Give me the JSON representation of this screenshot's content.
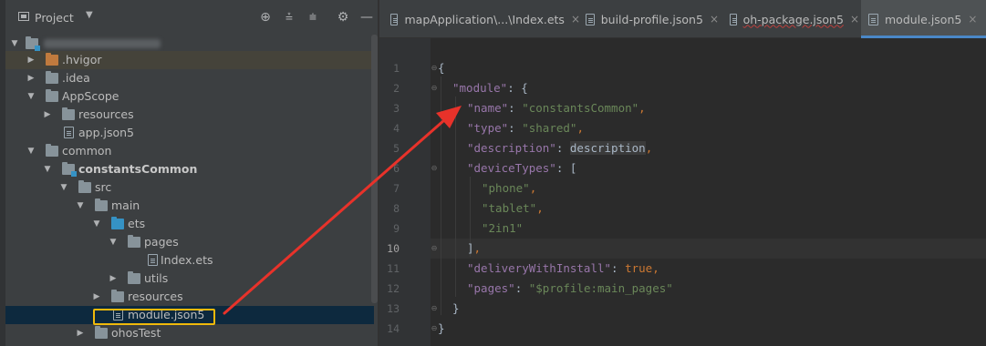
{
  "panel": {
    "title": "Project",
    "dropdown": "▼",
    "tools": [
      {
        "name": "locate-icon",
        "glyph": "⊕"
      },
      {
        "name": "expand-all-icon",
        "glyph": "⩮"
      },
      {
        "name": "collapse-all-icon",
        "glyph": "⩧"
      },
      {
        "name": "gear-icon",
        "glyph": "⚙"
      },
      {
        "name": "minimize-icon",
        "glyph": "—"
      }
    ]
  },
  "tree": {
    "hvigor": ".hvigor",
    "idea": ".idea",
    "appscope": "AppScope",
    "appscope_resources": "resources",
    "app_json5": "app.json5",
    "common": "common",
    "constants_common": "constantsCommon",
    "src": "src",
    "main": "main",
    "ets": "ets",
    "pages": "pages",
    "index_ets": "Index.ets",
    "utils": "utils",
    "main_resources": "resources",
    "module_json5": "module.json5",
    "ohos_test": "ohosTest"
  },
  "tabs": [
    {
      "label": "mapApplication\\...\\Index.ets",
      "close": "×"
    },
    {
      "label": "build-profile.json5",
      "close": "×"
    },
    {
      "label": "oh-package.json5",
      "close": "×"
    },
    {
      "label": "module.json5",
      "close": "×"
    }
  ],
  "editor": {
    "line_numbers": [
      "1",
      "2",
      "3",
      "4",
      "5",
      "6",
      "7",
      "8",
      "9",
      "10",
      "11",
      "12",
      "13",
      "14"
    ],
    "current_line": "10",
    "code": {
      "l1_open": "{",
      "l2_key": "\"module\"",
      "l2_rest": ": {",
      "l3_key": "\"name\"",
      "l3_colon": ": ",
      "l3_val": "\"constantsCommon\"",
      "l3_comma": ",",
      "l4_key": "\"type\"",
      "l4_colon": ": ",
      "l4_val": "\"shared\"",
      "l4_comma": ",",
      "l5_key": "\"description\"",
      "l5_colon": ": ",
      "l5_val": "description",
      "l5_comma": ",",
      "l6_key": "\"deviceTypes\"",
      "l6_rest": ": [",
      "l7_val": "\"phone\"",
      "l7_comma": ",",
      "l8_val": "\"tablet\"",
      "l8_comma": ",",
      "l9_val": "\"2in1\"",
      "l10_close": "]",
      "l10_comma": ",",
      "l11_key": "\"deliveryWithInstall\"",
      "l11_colon": ": ",
      "l11_val": "true",
      "l11_comma": ",",
      "l12_key": "\"pages\"",
      "l12_colon": ": ",
      "l12_val": "\"$profile:main_pages\"",
      "l13_close": "}",
      "l14_close": "}"
    }
  },
  "colors": {
    "annotation_arrow": "#e8322a",
    "annotation_box": "#f0b90b",
    "selected_tab_underline": "#4a88c7"
  }
}
